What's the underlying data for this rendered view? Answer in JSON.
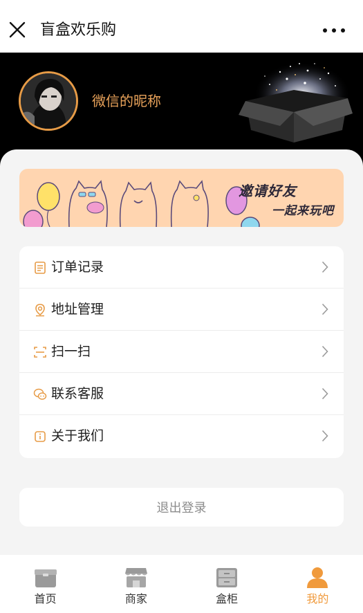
{
  "header": {
    "title": "盲盒欢乐购",
    "close_icon": "close-icon",
    "more_icon": "more-dots-icon"
  },
  "profile": {
    "nickname": "微信的昵称",
    "avatar_icon": "user-avatar"
  },
  "banner": {
    "line1": "邀请好友",
    "line2": "一起来玩吧",
    "bg_color": "#ffd5b0"
  },
  "menu": {
    "items": [
      {
        "label": "订单记录",
        "icon": "order-icon"
      },
      {
        "label": "地址管理",
        "icon": "location-icon"
      },
      {
        "label": "扫一扫",
        "icon": "scan-icon"
      },
      {
        "label": "联系客服",
        "icon": "chat-icon"
      },
      {
        "label": "关于我们",
        "icon": "info-icon"
      }
    ]
  },
  "logout": {
    "label": "退出登录"
  },
  "tabbar": {
    "tabs": [
      {
        "label": "首页",
        "icon": "home-box-icon"
      },
      {
        "label": "商家",
        "icon": "store-icon"
      },
      {
        "label": "盒柜",
        "icon": "cabinet-icon"
      },
      {
        "label": "我的",
        "icon": "profile-icon"
      }
    ],
    "active_color": "#f09a3c"
  },
  "colors": {
    "accent": "#e79b46",
    "header_bg": "#000000"
  }
}
